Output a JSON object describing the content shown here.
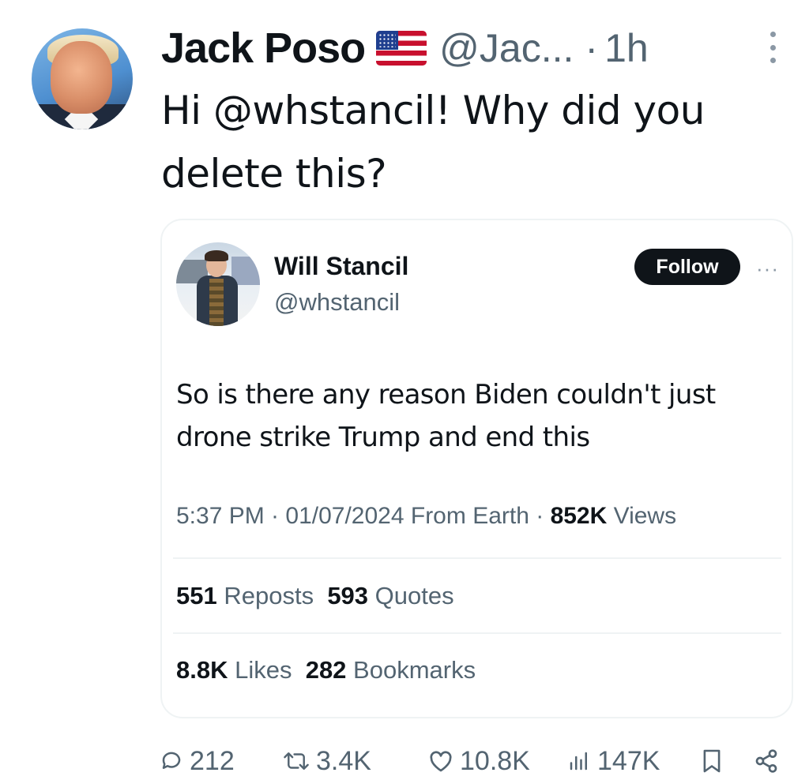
{
  "tweet": {
    "author_name": "Jack Poso",
    "flag_icon": "us-flag-icon",
    "handle": "@Jac...",
    "dot": "·",
    "time": "1h",
    "text": "Hi @whstancil! Why did you delete this?"
  },
  "quoted": {
    "author_name": "Will Stancil",
    "handle": "@whstancil",
    "follow_label": "Follow",
    "more_label": "···",
    "text": "So is there any reason Biden couldn't just drone strike Trump and end this",
    "timestamp": "5:37 PM · 01/07/2024 From Earth · ",
    "views_count": "852K",
    "views_label": " Views",
    "reposts_count": "551",
    "reposts_label": " Reposts",
    "quotes_count": "593",
    "quotes_label": " Quotes",
    "likes_count": "8.8K",
    "likes_label": " Likes",
    "bookmarks_count": "282",
    "bookmarks_label": " Bookmarks"
  },
  "actions": {
    "replies": "212",
    "reposts": "3.4K",
    "likes": "10.8K",
    "views": "147K",
    "icons": [
      "reply-icon",
      "retweet-icon",
      "like-icon",
      "views-icon",
      "bookmark-icon",
      "share-icon"
    ]
  },
  "colors": {
    "text_primary": "#0f1419",
    "text_secondary": "#536471",
    "border": "#eff3f4",
    "follow_bg": "#0f1419"
  }
}
